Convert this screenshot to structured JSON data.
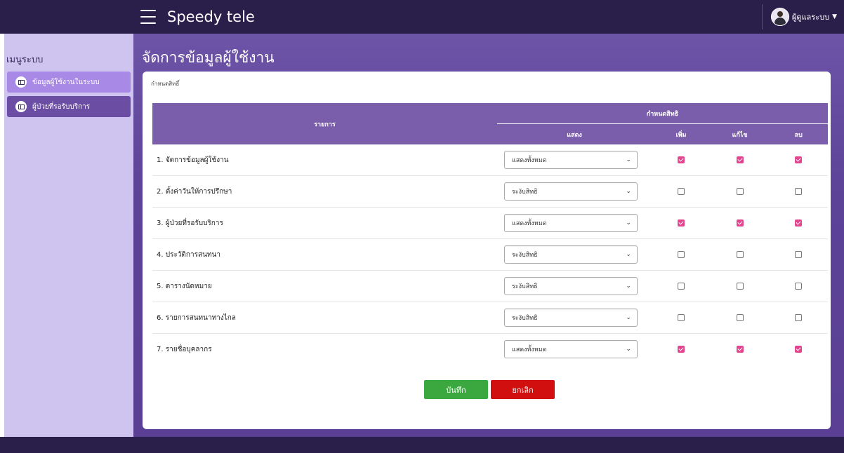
{
  "header": {
    "brand": "Speedy tele",
    "user_name": "ผู้ดูแลระบบ"
  },
  "sidebar": {
    "title": "เมนูระบบ",
    "items": [
      {
        "label": "ข้อมูลผู้ใช้งานในระบบ",
        "active": true
      },
      {
        "label": "ผู้ป่วยที่รอรับบริการ",
        "active": false
      }
    ]
  },
  "page": {
    "title": "จัดการข้อมูลผู้ใช้งาน",
    "caption": "กำหนดสิทธิ์"
  },
  "table": {
    "col_item": "รายการ",
    "col_group": "กำหนดสิทธิ",
    "col_view": "แสดง",
    "col_add": "เพิ่ม",
    "col_edit": "แก้ไข",
    "col_delete": "ลบ",
    "rows": [
      {
        "item": "1. จัดการข้อมูลผู้ใช้งาน",
        "view": "แสดงทั้งหมด",
        "add": true,
        "edit": true,
        "delete": true
      },
      {
        "item": "2. ตั้งค่าวันให้การปรึกษา",
        "view": "ระงับสิทธิ",
        "add": false,
        "edit": false,
        "delete": false
      },
      {
        "item": "3. ผู้ป่วยที่รอรับบริการ",
        "view": "แสดงทั้งหมด",
        "add": true,
        "edit": true,
        "delete": true
      },
      {
        "item": "4. ประวัติการสนทนา",
        "view": "ระงับสิทธิ",
        "add": false,
        "edit": false,
        "delete": false
      },
      {
        "item": "5. ตารางนัดหมาย",
        "view": "ระงับสิทธิ",
        "add": false,
        "edit": false,
        "delete": false
      },
      {
        "item": "6. รายการสนทนาทางไกล",
        "view": "ระงับสิทธิ",
        "add": false,
        "edit": false,
        "delete": false
      },
      {
        "item": "7. รายชื่อบุคลากร",
        "view": "แสดงทั้งหมด",
        "add": true,
        "edit": true,
        "delete": true
      }
    ]
  },
  "buttons": {
    "save": "บันทึก",
    "cancel": "ยกเลิก"
  },
  "colors": {
    "topbar": "#2a1e4a",
    "sidebar": "#cfc4f0",
    "table_header": "#7b5eab",
    "checkbox_on": "#e3468e",
    "save": "#3aa83f",
    "cancel": "#d10f0f"
  },
  "icons": {
    "menu": "hamburger-icon",
    "user": "user-avatar-icon",
    "dropdown": "chevron-down-icon",
    "sidebar_item": "book-icon"
  }
}
